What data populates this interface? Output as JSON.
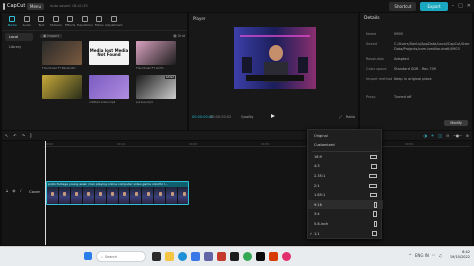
{
  "titlebar": {
    "app_name": "CapCut",
    "menu_label": "Menu",
    "autosave": "Auto saved: 18:41:29",
    "shortcut_label": "Shortcut",
    "export_label": "Export",
    "window_controls": [
      "–",
      "□",
      "✕"
    ]
  },
  "media": {
    "tabs": [
      {
        "label": "Media",
        "icon": "media-icon",
        "active": true
      },
      {
        "label": "Audio",
        "icon": "audio-icon"
      },
      {
        "label": "Text",
        "icon": "text-icon"
      },
      {
        "label": "Stickers",
        "icon": "stickers-icon"
      },
      {
        "label": "Effects",
        "icon": "effects-icon"
      },
      {
        "label": "Transitions",
        "icon": "transitions-icon"
      },
      {
        "label": "Filters",
        "icon": "filters-icon"
      },
      {
        "label": "Adjustment",
        "icon": "adjustment-icon"
      }
    ],
    "side_items": [
      {
        "label": "Local",
        "active": true
      },
      {
        "label": "Library"
      }
    ],
    "import_label": "Import",
    "grid_label": "Grid",
    "thumbs": [
      {
        "caption": "Thumbnail FT Bluetooth",
        "kind": "image",
        "colors": [
          "#2a2a2a",
          "#7b5a3f"
        ]
      },
      {
        "caption": "",
        "kind": "missing",
        "text": "Media lost Media Not Found"
      },
      {
        "caption": "Thumbnail FT Girlfr...",
        "kind": "image",
        "colors": [
          "#d9a3c0",
          "#1d1d1d"
        ]
      },
      {
        "caption": "",
        "kind": "image",
        "colors": [
          "#c7a93a",
          "#2a2f1a"
        ]
      },
      {
        "caption": "untitled video.mp4",
        "kind": "image",
        "colors": [
          "#7a5cc2",
          "#b08de0"
        ]
      },
      {
        "caption": "pursue.mp4",
        "kind": "image",
        "colors": [
          "#1a1a1a",
          "#cfcfcf"
        ],
        "added": "Added"
      }
    ]
  },
  "player": {
    "title": "Player",
    "timecode": "00:00:00:00",
    "duration": "00:00:20:02",
    "quality_label": "Quality",
    "fullscreen_label": "⤢",
    "ratio_label": "Ratio"
  },
  "details": {
    "title": "Details",
    "rows": [
      {
        "k": "Name",
        "v": "0903"
      },
      {
        "k": "Saved",
        "v": "C:/Users/Santu/AppData/Local/CapCut/User Data/Projects/com.lveditor.draft/0903"
      },
      {
        "k": "Resolution",
        "v": "Adapted"
      },
      {
        "k": "Color space",
        "v": "Standard SDR - Rec.709"
      },
      {
        "k": "Import method",
        "v": "Keep in original place"
      },
      {
        "k": "Proxy",
        "v": "Turned off"
      }
    ],
    "modify_label": "Modify"
  },
  "timeline": {
    "ticks": [
      "00:00",
      "00:10",
      "00:20",
      "00:30",
      "00:40",
      "00:50"
    ],
    "track_label": "Cover",
    "clip_name": "pluto footage young asian man playing online computer video game colorful l..."
  },
  "ratio_menu": {
    "items": [
      {
        "label": "Original",
        "checked": false,
        "w": 0,
        "h": 0
      },
      {
        "label": "Customized",
        "checked": false,
        "w": 0,
        "h": 0
      },
      {
        "label": "16:9",
        "checked": false,
        "w": 7,
        "h": 4
      },
      {
        "label": "4:3",
        "checked": false,
        "w": 6,
        "h": 4.5
      },
      {
        "label": "2.35:1",
        "checked": false,
        "w": 8,
        "h": 3.5
      },
      {
        "label": "2:1",
        "checked": false,
        "w": 8,
        "h": 4
      },
      {
        "label": "1.85:1",
        "checked": false,
        "w": 7.5,
        "h": 4
      },
      {
        "label": "9:16",
        "checked": false,
        "w": 3,
        "h": 6
      },
      {
        "label": "3:4",
        "checked": false,
        "w": 4.5,
        "h": 6
      },
      {
        "label": "5.8-inch",
        "checked": false,
        "w": 3,
        "h": 6.5
      },
      {
        "label": "1:1",
        "checked": true,
        "w": 5,
        "h": 5
      }
    ],
    "highlighted": "9:16"
  },
  "taskbar": {
    "search_label": "Search",
    "time": "6:42",
    "date": "19/10/2022",
    "tray_lang": "ENG IN"
  }
}
